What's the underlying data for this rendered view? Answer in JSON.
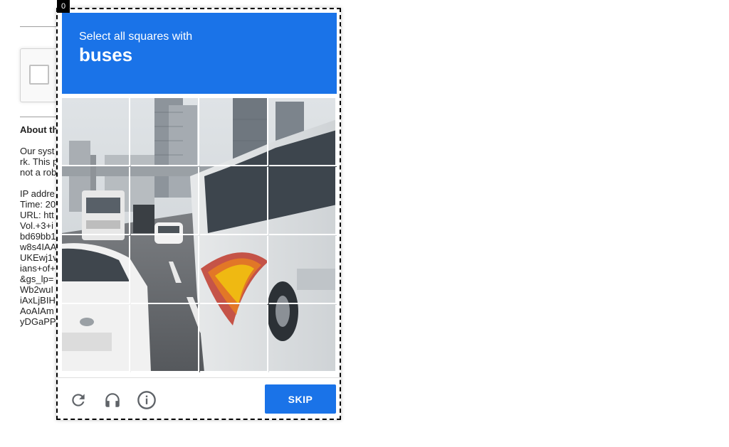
{
  "background_page": {
    "heading": "About th",
    "paragraph_lines": [
      "Our syst",
      "rk. This p",
      "not a rob"
    ],
    "detail_lines": [
      "IP addre",
      "Time: 20",
      "URL: htt",
      "Vol.+3+i",
      "bd69bb1",
      "w8s4IAA",
      "UKEwj1v",
      "ians+of+",
      "&gs_lp=",
      "Wb2wuI",
      "iAxLjBIH",
      "AoAIAm",
      "yDGaPP"
    ]
  },
  "challenge": {
    "index_badge": "0",
    "instruction": "Select all squares with",
    "target": "buses",
    "grid": {
      "rows": 4,
      "cols": 4
    },
    "skip_label": "SKIP",
    "icons": [
      "reload-icon",
      "audio-icon",
      "info-icon"
    ]
  },
  "colors": {
    "accent": "#1a73e8",
    "header_text": "#ffffff"
  }
}
